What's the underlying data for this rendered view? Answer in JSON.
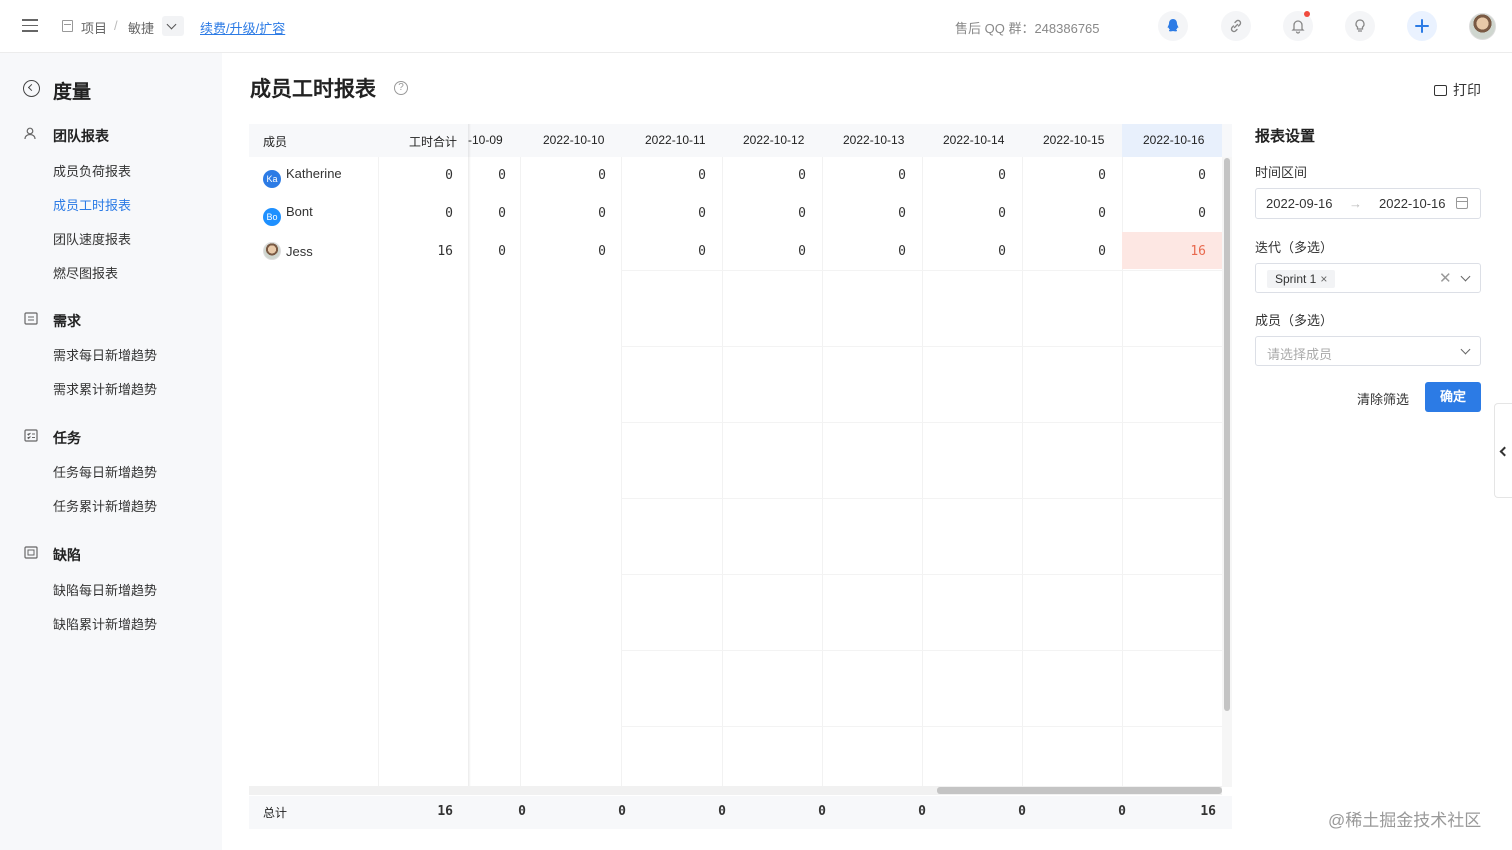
{
  "header": {
    "breadcrumb": [
      "项目",
      "/",
      "敏捷"
    ],
    "renew_link": "续费/升级/扩容",
    "qq_group": "售后 QQ 群：248386765",
    "icons": [
      "qq-icon",
      "link-icon",
      "bell-icon",
      "bulb-icon",
      "add-icon"
    ],
    "accent": "#2c7be5"
  },
  "sidebar": {
    "title": "度量",
    "groups": [
      {
        "label": "团队报表",
        "items": [
          "成员负荷报表",
          "成员工时报表",
          "团队速度报表",
          "燃尽图报表"
        ]
      },
      {
        "label": "需求",
        "items": [
          "需求每日新增趋势",
          "需求累计新增趋势"
        ]
      },
      {
        "label": "任务",
        "items": [
          "任务每日新增趋势",
          "任务累计新增趋势"
        ]
      },
      {
        "label": "缺陷",
        "items": [
          "缺陷每日新增趋势",
          "缺陷累计新增趋势"
        ]
      }
    ],
    "active_item": "成员工时报表"
  },
  "main": {
    "title": "成员工时报表",
    "help": "?",
    "print_label": "打印"
  },
  "table": {
    "columns": [
      "成员",
      "工时合计",
      "-10-09",
      "2022-10-10",
      "2022-10-11",
      "2022-10-12",
      "2022-10-13",
      "2022-10-14",
      "2022-10-15",
      "2022-10-16"
    ],
    "rows": [
      {
        "avatar": "Ka",
        "name": "Katherine",
        "total": "0",
        "days": [
          "0",
          "0",
          "0",
          "0",
          "0",
          "0",
          "0",
          "0"
        ]
      },
      {
        "avatar": "Bo",
        "name": "Bont",
        "total": "0",
        "days": [
          "0",
          "0",
          "0",
          "0",
          "0",
          "0",
          "0",
          "0"
        ]
      },
      {
        "avatar": "",
        "name": "Jess",
        "total": "16",
        "days": [
          "0",
          "0",
          "0",
          "0",
          "0",
          "0",
          "0",
          "16"
        ]
      }
    ],
    "footer": {
      "label": "总计",
      "total": "16",
      "days": [
        "0",
        "0",
        "0",
        "0",
        "0",
        "0",
        "0",
        "16"
      ]
    },
    "highlight_color": "#fde7e3"
  },
  "panel": {
    "title": "报表设置",
    "time_label": "时间区间",
    "start_date": "2022-09-16",
    "arrow": "→",
    "end_date": "2022-10-16",
    "iteration_label": "迭代（多选）",
    "iteration_tag": "Sprint 1",
    "tag_remove": "×",
    "clear_icon": "✕",
    "member_label": "成员（多选）",
    "member_placeholder": "请选择成员",
    "clear_button": "清除筛选",
    "ok_button": "确定"
  },
  "watermark": "@稀土掘金技术社区"
}
